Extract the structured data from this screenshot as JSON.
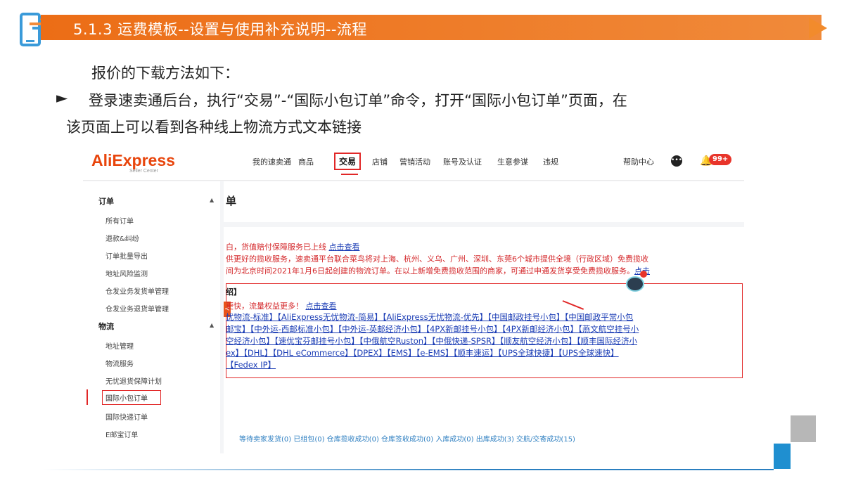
{
  "slide": {
    "title": "5.1.3 运费模板--设置与使用补充说明--流程",
    "intro": "报价的下载方法如下：",
    "bullet_symbol": "►",
    "bullet_line1": "登录速卖通后台，执行“交易”-“国际小包订单”命令，打开“国际小包订单”页面，在",
    "bullet_line2": "该页面上可以看到各种线上物流方式文本链接"
  },
  "app": {
    "logo": "AliExpress",
    "logo_sub": "Seller Center",
    "nav": [
      "我的速卖通",
      "商品",
      "交易",
      "店铺",
      "营销活动",
      "账号及认证",
      "生意参谋",
      "违规"
    ],
    "nav_active_index": 2,
    "help": "帮助中心",
    "badge": "99+"
  },
  "sidebar": {
    "section_orders": "订单",
    "orders": [
      "所有订单",
      "退款&纠纷",
      "订单批量导出",
      "地址风险监测",
      "仓发业务发货单管理",
      "仓发业务退货单管理"
    ],
    "section_logistics": "物流",
    "logistics": [
      "地址管理",
      "物流服务",
      "无忧退货保障计划",
      "国际小包订单",
      "国际快递订单",
      "E邮宝订单"
    ],
    "active_item": "国际小包订单",
    "caret": "▲"
  },
  "main": {
    "title": "单",
    "notice1_text": "白，货值赔付保障服务已上线 ",
    "notice1_link": "点击查看",
    "notice2": "供更好的揽收服务，速卖通平台联合菜鸟将对上海、杭州、义乌、广州、深圳、东莞6个城市提供全境（行政区域）免费揽收",
    "notice3_text": "间为北京时间2021年1月6日起创建的物流订单。在以上新增免费揽收范围的商家，可通过申通发货享受免费揽收服务。",
    "notice3_link": "点击",
    "section_head": "绍】",
    "promo_text": "更快，流量权益更多！ ",
    "promo_link": "点击查看",
    "logistics_lines": [
      "忧物流-标准】【AliExpress无忧物流-简易】【AliExpress无忧物流-优先】【中国邮政挂号小包】【中国邮政平常小包",
      "邮宝】【中外运-西邮标准小包】【中外运-英邮经济小包】【4PX新邮挂号小包】【4PX新邮经济小包】【燕文航空挂号小",
      "空经济小包】【速优宝芬邮挂号小包】【中俄航空Ruston】【中俄快递-SPSR】【顺友航空经济小包】【顺丰国际经济小",
      "ex】【DHL】【DHL eCommerce】【DPEX】【EMS】【e-EMS】【顺丰速运】【UPS全球快捷】【UPS全球速快】",
      "【Fedex IP】"
    ],
    "status_strip": "等待卖家发货(0)  已组包(0)  仓库揽收成功(0)  仓库签收成功(0)  入库成功(0)  出库成功(3)  交航/交寄成功(15)"
  },
  "colors": {
    "accent_orange": "#ec6d16",
    "highlight_red": "#e12727",
    "link_blue": "#1a3cb5",
    "footer_blue": "#1f8fd0"
  }
}
